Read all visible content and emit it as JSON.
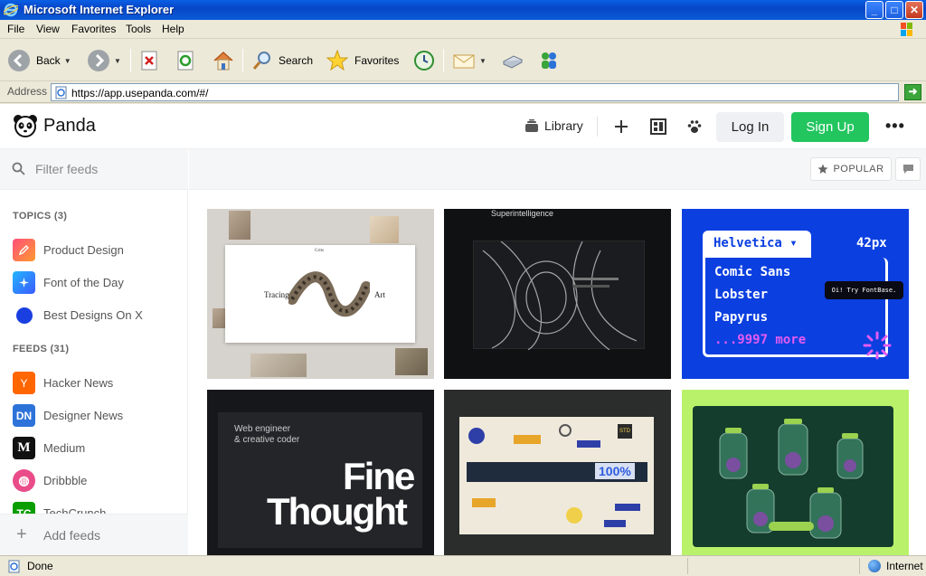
{
  "window": {
    "title": "Microsoft Internet Explorer",
    "controls": {
      "minimize": "_",
      "maximize": "□",
      "close": "✕"
    }
  },
  "menu": [
    "File",
    "View",
    "Favorites",
    "Tools",
    "Help"
  ],
  "toolbar": {
    "back": "Back",
    "search": "Search",
    "favorites": "Favorites"
  },
  "address": {
    "label": "Address",
    "url": "https://app.usepanda.com/#/"
  },
  "panda": {
    "brand": "Panda",
    "header": {
      "library": "Library",
      "login": "Log In",
      "signup": "Sign Up",
      "more": "•••"
    },
    "filter_placeholder": "Filter feeds",
    "popular": "POPULAR",
    "topics_title": "TOPICS (3)",
    "topics": [
      {
        "label": "Product Design",
        "icon": "pencil-icon",
        "color": "#ff6a3d"
      },
      {
        "label": "Font of the Day",
        "icon": "sparkle-icon",
        "color": "#2d8cff"
      },
      {
        "label": "Best Designs On X",
        "icon": "circle-icon",
        "color": "#1a3fe0"
      }
    ],
    "feeds_title": "FEEDS (31)",
    "feeds": [
      {
        "label": "Hacker News",
        "badge": "Y",
        "color": "#ff6600"
      },
      {
        "label": "Designer News",
        "badge": "DN",
        "color": "#2d72d9"
      },
      {
        "label": "Medium",
        "badge": "M",
        "color": "#111111"
      },
      {
        "label": "Dribbble",
        "badge": "◍",
        "color": "#ea4c89"
      },
      {
        "label": "TechCrunch",
        "badge": "TC",
        "color": "#0a9e01"
      }
    ],
    "add_feeds": "Add feeds",
    "cards": {
      "c1": {
        "cap0": "Grits",
        "cap1": "Tracing",
        "cap2": "Art"
      },
      "c2": {
        "head": "Superintelligence"
      },
      "c3": {
        "tab": "Helvetica ▾",
        "size": "42px",
        "fonts": [
          "Comic Sans",
          "Lobster",
          "Papyrus"
        ],
        "more": "...9997 more",
        "tooltip": "Oi! Try FontBase."
      },
      "c4": {
        "small1": "Web engineer",
        "small2": "& creative coder",
        "big1": "Fine",
        "big2": "Thought"
      },
      "c5": {
        "pct": "100%",
        "std": "STD"
      }
    }
  },
  "status": {
    "text": "Done",
    "zone": "Internet"
  },
  "colors": {
    "xp_blue": "#0746c6",
    "signup_green": "#22c55e",
    "fontbase_blue": "#0b3fe0",
    "lime": "#b9f26a"
  }
}
